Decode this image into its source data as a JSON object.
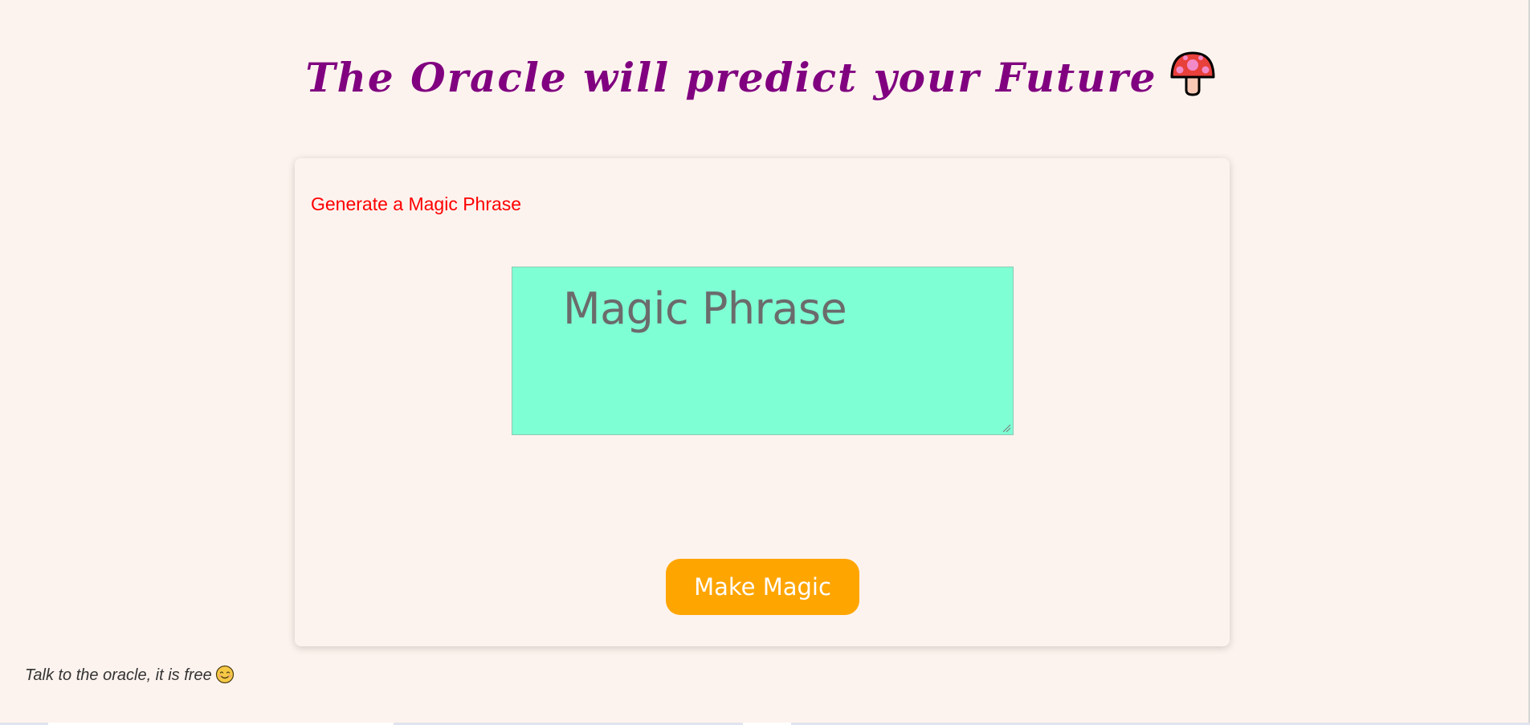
{
  "header": {
    "title": "The Oracle will predict your Future",
    "title_icon": "mushroom-icon",
    "title_color": "#800080"
  },
  "card": {
    "heading": "Generate a Magic Phrase",
    "heading_color": "#ff0000",
    "phrase_box": {
      "text": "Magic Phrase",
      "background": "#7fffd4"
    },
    "button": {
      "label": "Make Magic",
      "color": "#ffa500"
    }
  },
  "footer": {
    "note": "Talk to the oracle, it is free",
    "note_icon": "smiling-face-icon"
  },
  "colors": {
    "page_background": "#fdf3ee"
  }
}
